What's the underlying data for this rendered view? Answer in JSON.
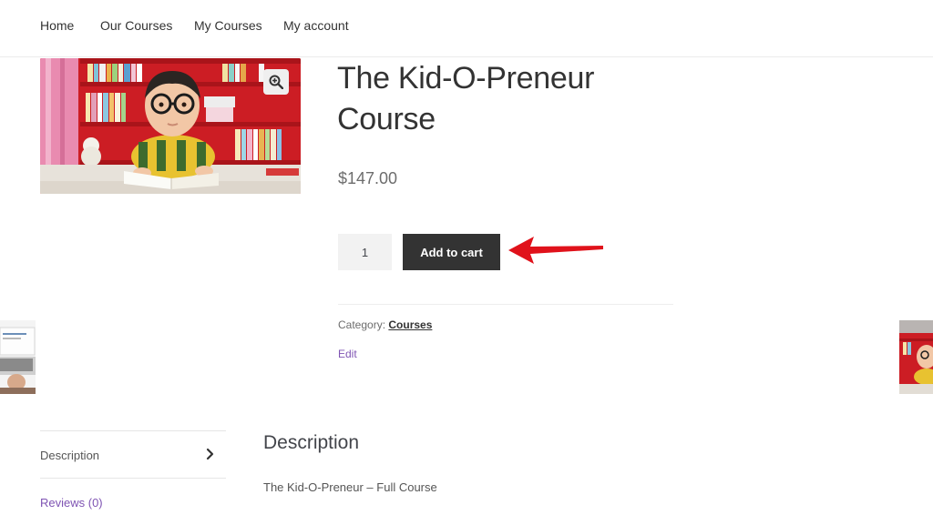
{
  "nav": {
    "items": [
      {
        "label": "Home"
      },
      {
        "label": "Our Courses"
      },
      {
        "label": "My Courses"
      },
      {
        "label": "My account"
      }
    ]
  },
  "product": {
    "title": "The Kid-O-Preneur Course",
    "price": "$147.00",
    "quantity": "1",
    "add_to_cart_label": "Add to cart",
    "category_label": "Category:",
    "category_value": "Courses",
    "edit_label": "Edit"
  },
  "tabs": {
    "description_label": "Description",
    "reviews_label": "Reviews (0)"
  },
  "description": {
    "heading": "Description",
    "text": "The Kid-O-Preneur – Full Course"
  },
  "colors": {
    "button": "#333333",
    "link": "#7f54b3",
    "arrow": "#e0121b",
    "image_bg": "#d01f26"
  },
  "icons": {
    "zoom": "magnifier-plus-icon",
    "tab": "chevron-right-icon",
    "annotation": "red-arrow-icon"
  }
}
